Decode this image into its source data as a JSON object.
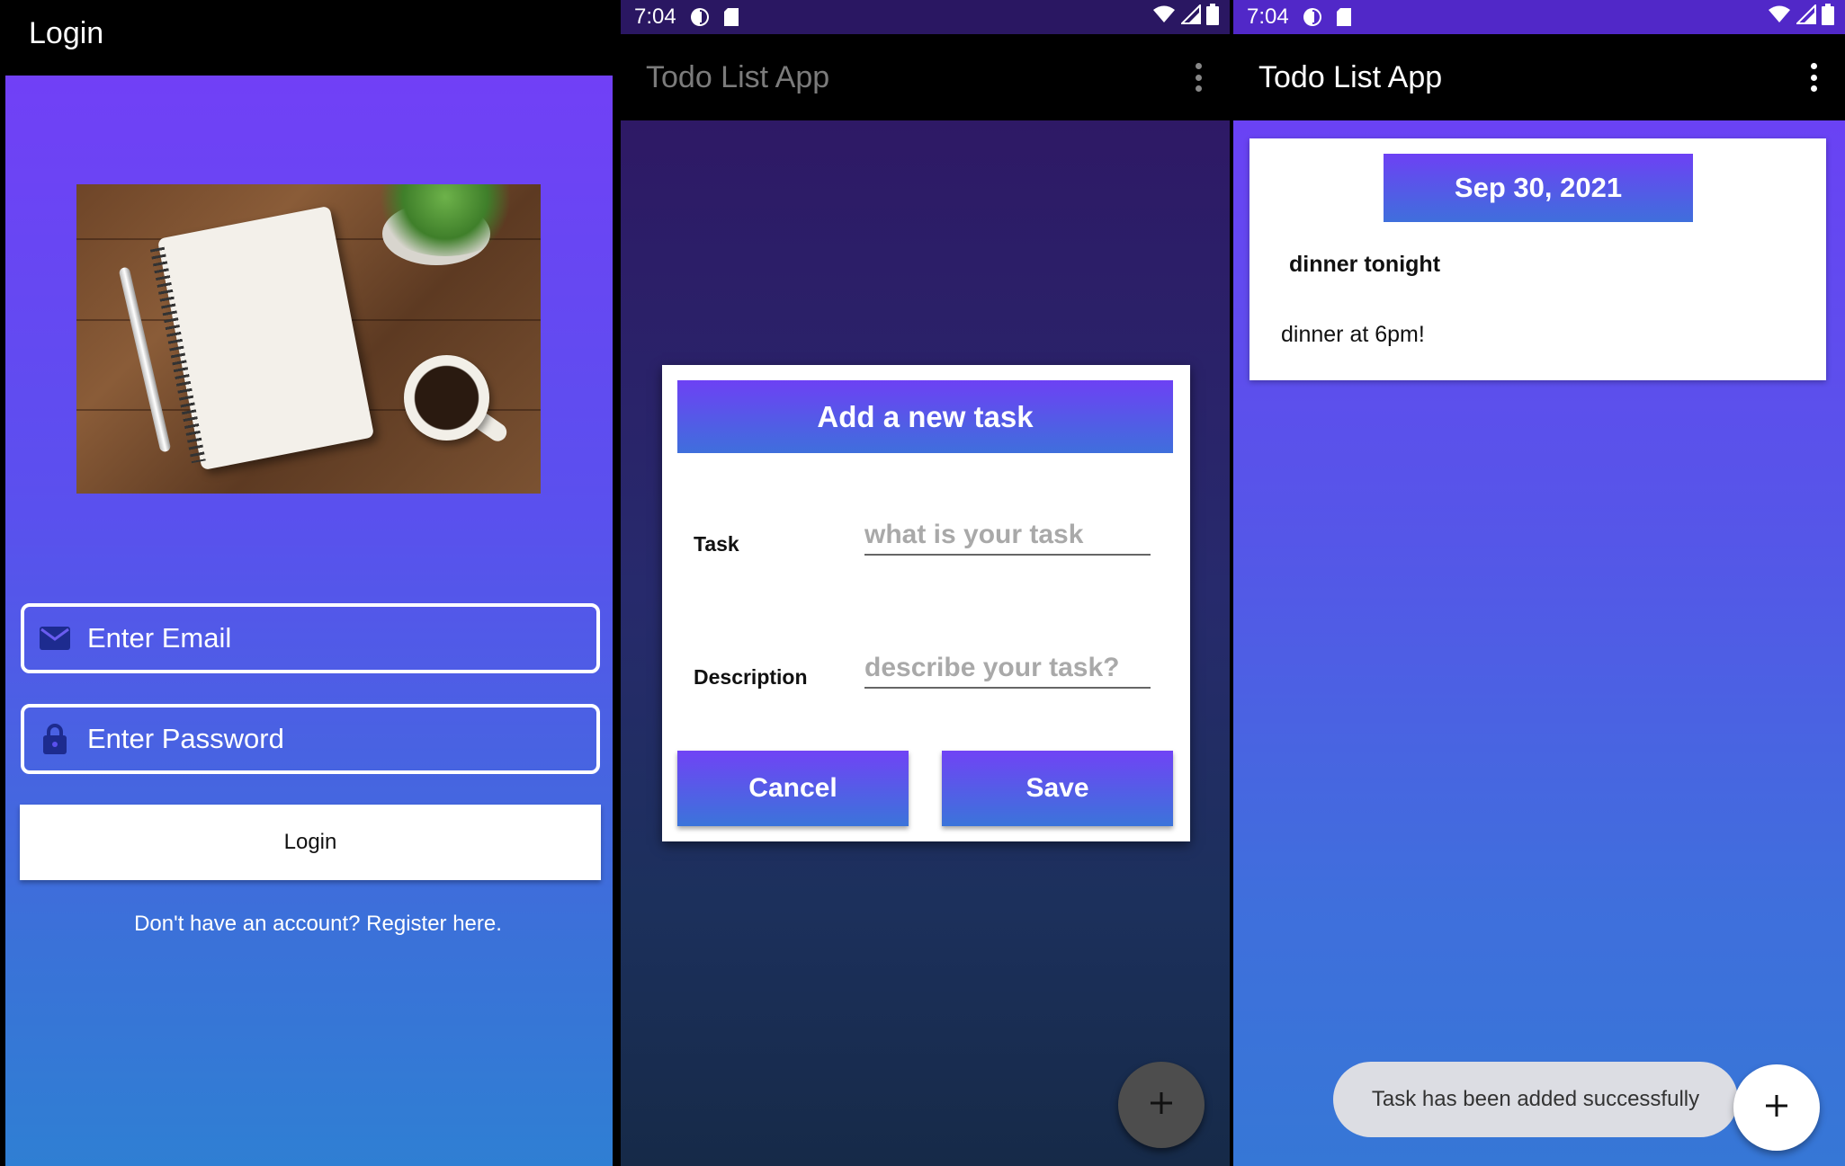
{
  "login_screen": {
    "title": "Login",
    "email_placeholder": "Enter Email",
    "password_placeholder": "Enter Password",
    "login_button": "Login",
    "register_link": "Don't have an account? Register here."
  },
  "add_task_screen": {
    "status_time": "7:04",
    "app_title": "Todo List App",
    "dialog": {
      "title": "Add a new task",
      "task_label": "Task",
      "task_placeholder": "what is your task",
      "description_label": "Description",
      "description_placeholder": "describe your task?",
      "cancel_button": "Cancel",
      "save_button": "Save"
    }
  },
  "task_list_screen": {
    "status_time": "7:04",
    "app_title": "Todo List App",
    "tasks": [
      {
        "date": "Sep 30, 2021",
        "title": "dinner tonight",
        "description": "dinner at 6pm!"
      }
    ],
    "toast": "Task has been added successfully"
  },
  "icons": {
    "email": "envelope-icon",
    "password": "lock-icon",
    "overflow": "more-vert-icon",
    "fab": "plus-icon",
    "status": [
      "data-saver-icon",
      "sd-card-icon",
      "wifi-icon",
      "signal-icon",
      "battery-icon"
    ]
  },
  "colors": {
    "gradient_top": "#7140f6",
    "gradient_bottom": "#2f7fd3",
    "dialog_scrim": "#272a6c",
    "toast_bg": "#dcdde3"
  }
}
